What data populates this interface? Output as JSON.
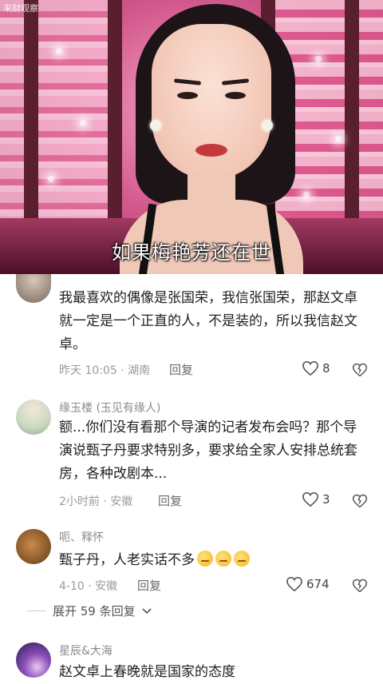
{
  "video": {
    "watermark": "来财观察",
    "subtitle": "如果梅艳芳还在世"
  },
  "comments": [
    {
      "username": "",
      "text": "我最喜欢的偶像是张国荣，我信张国荣，那赵文卓就一定是一个正直的人，不是装的，所以我信赵文卓。",
      "time_location": "昨天 10:05 · 湖南",
      "reply_label": "回复",
      "likes": "8"
    },
    {
      "username": "缘玉楼 (玉见有缘人)",
      "text": "额...你们没有看那个导演的记者发布会吗？那个导演说甄子丹要求特别多，要求给全家人安排总统套房，各种改剧本...",
      "time_location": "2小时前 · 安徽",
      "reply_label": "回复",
      "likes": "3"
    },
    {
      "username": "呃、释怀",
      "text": "甄子丹，人老实话不多",
      "time_location": "4-10 · 安徽",
      "reply_label": "回复",
      "likes": "674",
      "emoji_count": 3
    },
    {
      "username": "星辰&大海",
      "text": "赵文卓上春晚就是国家的态度"
    }
  ],
  "expand_replies": {
    "label": "展开 59 条回复"
  },
  "icons": {
    "like": "heart-outline-icon",
    "dislike": "broken-heart-icon",
    "expand": "chevron-down-icon"
  }
}
